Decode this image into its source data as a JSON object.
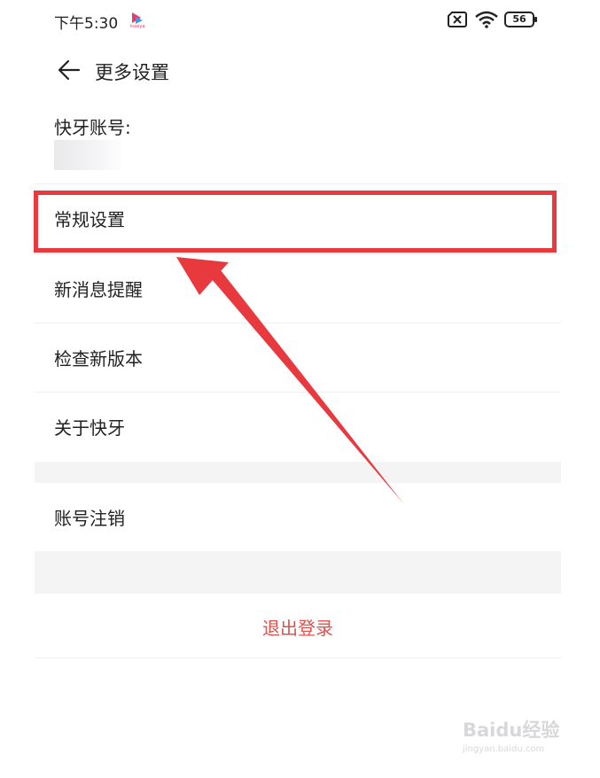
{
  "status_bar": {
    "time": "下午5:30",
    "battery_level": "56",
    "icons": [
      "app-logo-icon",
      "no-sim-icon",
      "wifi-icon",
      "battery-icon"
    ]
  },
  "nav": {
    "title": "更多设置",
    "back_icon": "arrow-left-icon"
  },
  "account": {
    "label": "快牙账号:"
  },
  "menu": {
    "items": [
      {
        "label": "常规设置"
      },
      {
        "label": "新消息提醒"
      },
      {
        "label": "检查新版本"
      },
      {
        "label": "关于快牙"
      }
    ],
    "account_cancel": "账号注销",
    "logout": "退出登录"
  },
  "colors": {
    "highlight": "#e8393e",
    "logout_text": "#e0504e",
    "section_gap": "#f4f4f4"
  },
  "watermark": {
    "brand": "Baidu经验",
    "url": "jingyan.baidu.com"
  }
}
